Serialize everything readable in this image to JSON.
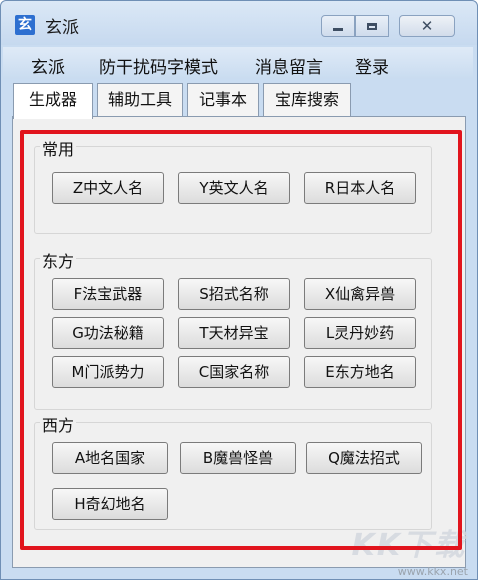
{
  "window": {
    "title": "玄派",
    "app_icon_glyph": "玄",
    "close_glyph": "✕"
  },
  "menu": [
    "玄派",
    "防干扰码字模式",
    "消息留言",
    "登录"
  ],
  "tabs": [
    "生成器",
    "辅助工具",
    "记事本",
    "宝库搜索"
  ],
  "groups": {
    "common": {
      "label": "常用",
      "buttons": [
        "Z中文人名",
        "Y英文人名",
        "R日本人名"
      ]
    },
    "east": {
      "label": "东方",
      "buttons": [
        "F法宝武器",
        "S招式名称",
        "X仙禽异兽",
        "G功法秘籍",
        "T天材异宝",
        "L灵丹妙药",
        "M门派势力",
        "C国家名称",
        "E东方地名"
      ]
    },
    "west": {
      "label": "西方",
      "buttons": [
        "A地名国家",
        "B魔兽怪兽",
        "Q魔法招式",
        "H奇幻地名"
      ]
    }
  },
  "watermark": {
    "logo": "KK下载",
    "url": "www.kkx.net"
  },
  "colors": {
    "highlight": "#e1141d",
    "title_bg": "#c9dcf1"
  }
}
